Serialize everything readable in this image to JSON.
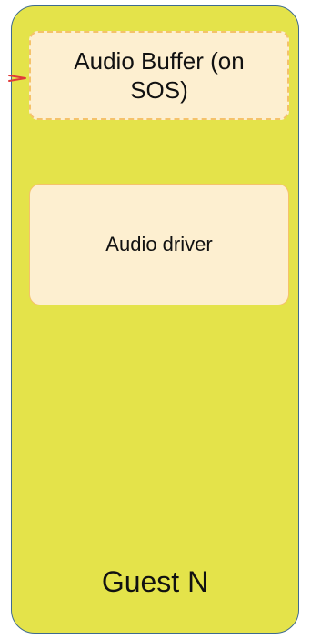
{
  "diagram": {
    "container": {
      "label": "Guest N",
      "fill_color": "#e4e34a",
      "border_color": "#3e6b8f"
    },
    "nodes": [
      {
        "id": "audio-buffer",
        "label": "Audio Buffer (on SOS)",
        "style": "dashed",
        "fill_color": "#fdefd0",
        "border_color": "#f5c26a"
      },
      {
        "id": "audio-driver",
        "label": "Audio driver",
        "style": "solid",
        "fill_color": "#fdefd0",
        "border_color": "#f5c26a"
      }
    ],
    "edges": [
      {
        "to": "audio-buffer",
        "color": "#e03a3a",
        "description": "arrow entering from the left edge"
      }
    ]
  }
}
